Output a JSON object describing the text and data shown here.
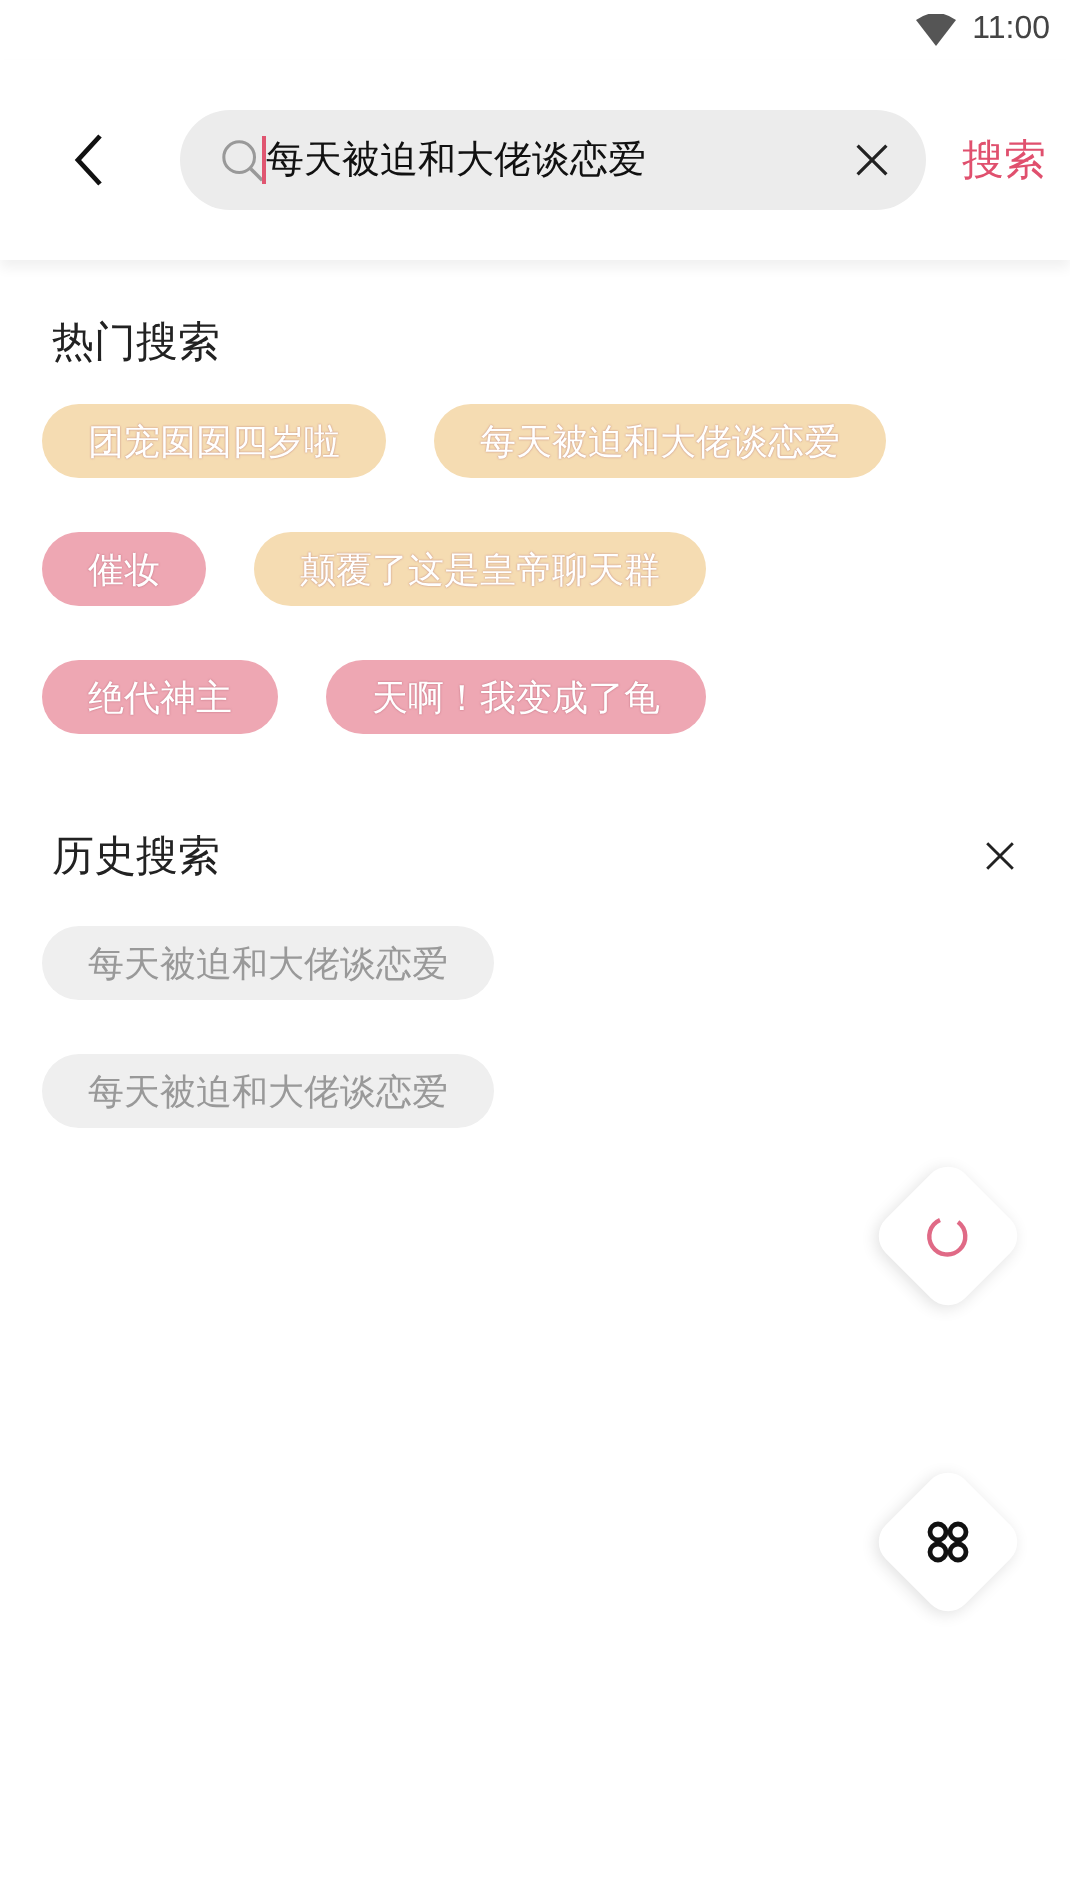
{
  "status_bar": {
    "time": "11:00"
  },
  "search": {
    "value": "每天被迫和大佬谈恋爱",
    "button": "搜索"
  },
  "hot": {
    "title": "热门搜索",
    "tags": [
      {
        "text": "团宠囡囡四岁啦",
        "color": "#f5dcb2"
      },
      {
        "text": "每天被迫和大佬谈恋爱",
        "color": "#f5dcb2"
      },
      {
        "text": "催妆",
        "color": "#eea7b3"
      },
      {
        "text": "颠覆了这是皇帝聊天群",
        "color": "#f5dcb2"
      },
      {
        "text": "绝代神主",
        "color": "#eea7b3"
      },
      {
        "text": "天啊！我变成了龟",
        "color": "#eea7b3"
      }
    ]
  },
  "history": {
    "title": "历史搜索",
    "items": [
      "每天被迫和大佬谈恋爱",
      "每天被迫和大佬谈恋爱"
    ]
  }
}
